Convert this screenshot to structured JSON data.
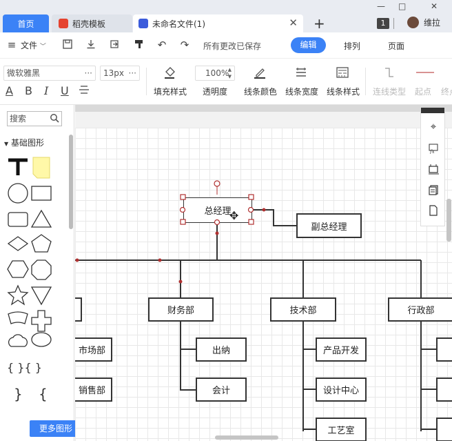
{
  "tabs": {
    "home": "首页",
    "template": "稻壳模板",
    "document": "未命名文件(1)"
  },
  "window": {
    "badge": "1",
    "user_name": "维拉",
    "minimize": "—",
    "maximize": "□",
    "close": "✕"
  },
  "menubar": {
    "file": "文件",
    "save_status": "所有更改已保存",
    "mode_edit": "编辑",
    "mode_arrange": "排列",
    "mode_page": "页面"
  },
  "format": {
    "font_family": "微软雅黑",
    "font_size": "13px",
    "opacity": "100%",
    "fill_style": "填充样式",
    "opacity_label": "透明度",
    "line_color": "线条颜色",
    "line_width": "线条宽度",
    "line_style": "线条样式",
    "connector_type": "连线类型",
    "start_point": "起点",
    "end_point": "终点",
    "letters": {
      "underline_a": "A",
      "bold": "B",
      "italic": "I",
      "underline": "U"
    }
  },
  "leftpanel": {
    "search_placeholder": "搜索",
    "category": "基础图形",
    "more_shapes": "更多图形"
  },
  "org_chart": {
    "ceo": "总经理",
    "vice": "副总经理",
    "departments": [
      {
        "name": "财务部",
        "children": [
          "出纳",
          "会计"
        ]
      },
      {
        "name": "技术部",
        "children": [
          "产品开发",
          "设计中心",
          "工艺室"
        ]
      },
      {
        "name": "行政部",
        "children": []
      }
    ],
    "left_partial": [
      "市场部",
      "销售部"
    ]
  },
  "colors": {
    "accent": "#3b82f6",
    "selection_handle": "#b03030",
    "node_border": "#333333"
  }
}
